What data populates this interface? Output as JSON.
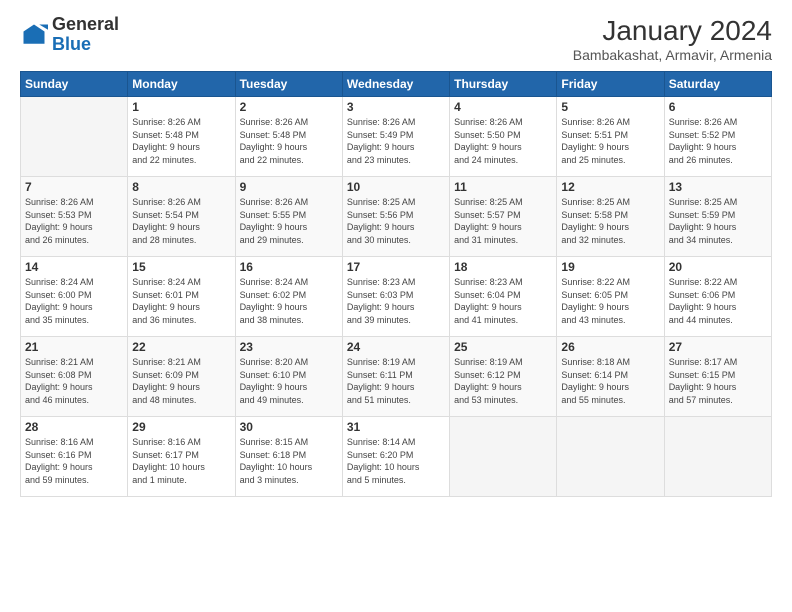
{
  "header": {
    "logo_general": "General",
    "logo_blue": "Blue",
    "month_title": "January 2024",
    "subtitle": "Bambakashat, Armavir, Armenia"
  },
  "columns": [
    "Sunday",
    "Monday",
    "Tuesday",
    "Wednesday",
    "Thursday",
    "Friday",
    "Saturday"
  ],
  "weeks": [
    [
      {
        "num": "",
        "info": ""
      },
      {
        "num": "1",
        "info": "Sunrise: 8:26 AM\nSunset: 5:48 PM\nDaylight: 9 hours\nand 22 minutes."
      },
      {
        "num": "2",
        "info": "Sunrise: 8:26 AM\nSunset: 5:48 PM\nDaylight: 9 hours\nand 22 minutes."
      },
      {
        "num": "3",
        "info": "Sunrise: 8:26 AM\nSunset: 5:49 PM\nDaylight: 9 hours\nand 23 minutes."
      },
      {
        "num": "4",
        "info": "Sunrise: 8:26 AM\nSunset: 5:50 PM\nDaylight: 9 hours\nand 24 minutes."
      },
      {
        "num": "5",
        "info": "Sunrise: 8:26 AM\nSunset: 5:51 PM\nDaylight: 9 hours\nand 25 minutes."
      },
      {
        "num": "6",
        "info": "Sunrise: 8:26 AM\nSunset: 5:52 PM\nDaylight: 9 hours\nand 26 minutes."
      }
    ],
    [
      {
        "num": "7",
        "info": "Sunrise: 8:26 AM\nSunset: 5:53 PM\nDaylight: 9 hours\nand 26 minutes."
      },
      {
        "num": "8",
        "info": "Sunrise: 8:26 AM\nSunset: 5:54 PM\nDaylight: 9 hours\nand 28 minutes."
      },
      {
        "num": "9",
        "info": "Sunrise: 8:26 AM\nSunset: 5:55 PM\nDaylight: 9 hours\nand 29 minutes."
      },
      {
        "num": "10",
        "info": "Sunrise: 8:25 AM\nSunset: 5:56 PM\nDaylight: 9 hours\nand 30 minutes."
      },
      {
        "num": "11",
        "info": "Sunrise: 8:25 AM\nSunset: 5:57 PM\nDaylight: 9 hours\nand 31 minutes."
      },
      {
        "num": "12",
        "info": "Sunrise: 8:25 AM\nSunset: 5:58 PM\nDaylight: 9 hours\nand 32 minutes."
      },
      {
        "num": "13",
        "info": "Sunrise: 8:25 AM\nSunset: 5:59 PM\nDaylight: 9 hours\nand 34 minutes."
      }
    ],
    [
      {
        "num": "14",
        "info": "Sunrise: 8:24 AM\nSunset: 6:00 PM\nDaylight: 9 hours\nand 35 minutes."
      },
      {
        "num": "15",
        "info": "Sunrise: 8:24 AM\nSunset: 6:01 PM\nDaylight: 9 hours\nand 36 minutes."
      },
      {
        "num": "16",
        "info": "Sunrise: 8:24 AM\nSunset: 6:02 PM\nDaylight: 9 hours\nand 38 minutes."
      },
      {
        "num": "17",
        "info": "Sunrise: 8:23 AM\nSunset: 6:03 PM\nDaylight: 9 hours\nand 39 minutes."
      },
      {
        "num": "18",
        "info": "Sunrise: 8:23 AM\nSunset: 6:04 PM\nDaylight: 9 hours\nand 41 minutes."
      },
      {
        "num": "19",
        "info": "Sunrise: 8:22 AM\nSunset: 6:05 PM\nDaylight: 9 hours\nand 43 minutes."
      },
      {
        "num": "20",
        "info": "Sunrise: 8:22 AM\nSunset: 6:06 PM\nDaylight: 9 hours\nand 44 minutes."
      }
    ],
    [
      {
        "num": "21",
        "info": "Sunrise: 8:21 AM\nSunset: 6:08 PM\nDaylight: 9 hours\nand 46 minutes."
      },
      {
        "num": "22",
        "info": "Sunrise: 8:21 AM\nSunset: 6:09 PM\nDaylight: 9 hours\nand 48 minutes."
      },
      {
        "num": "23",
        "info": "Sunrise: 8:20 AM\nSunset: 6:10 PM\nDaylight: 9 hours\nand 49 minutes."
      },
      {
        "num": "24",
        "info": "Sunrise: 8:19 AM\nSunset: 6:11 PM\nDaylight: 9 hours\nand 51 minutes."
      },
      {
        "num": "25",
        "info": "Sunrise: 8:19 AM\nSunset: 6:12 PM\nDaylight: 9 hours\nand 53 minutes."
      },
      {
        "num": "26",
        "info": "Sunrise: 8:18 AM\nSunset: 6:14 PM\nDaylight: 9 hours\nand 55 minutes."
      },
      {
        "num": "27",
        "info": "Sunrise: 8:17 AM\nSunset: 6:15 PM\nDaylight: 9 hours\nand 57 minutes."
      }
    ],
    [
      {
        "num": "28",
        "info": "Sunrise: 8:16 AM\nSunset: 6:16 PM\nDaylight: 9 hours\nand 59 minutes."
      },
      {
        "num": "29",
        "info": "Sunrise: 8:16 AM\nSunset: 6:17 PM\nDaylight: 10 hours\nand 1 minute."
      },
      {
        "num": "30",
        "info": "Sunrise: 8:15 AM\nSunset: 6:18 PM\nDaylight: 10 hours\nand 3 minutes."
      },
      {
        "num": "31",
        "info": "Sunrise: 8:14 AM\nSunset: 6:20 PM\nDaylight: 10 hours\nand 5 minutes."
      },
      {
        "num": "",
        "info": ""
      },
      {
        "num": "",
        "info": ""
      },
      {
        "num": "",
        "info": ""
      }
    ]
  ]
}
